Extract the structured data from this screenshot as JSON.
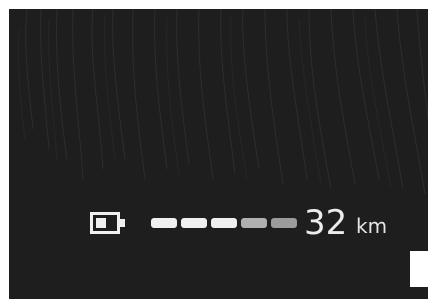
{
  "range_display": {
    "value": "32",
    "unit": "km",
    "icon": "battery-icon",
    "segments": [
      {
        "state": "filled",
        "color": "#f0f0f0"
      },
      {
        "state": "filled",
        "color": "#f0f0f0"
      },
      {
        "state": "filled",
        "color": "#f0f0f0"
      },
      {
        "state": "dim",
        "color": "#b0b0b0"
      },
      {
        "state": "dim",
        "color": "#9c9c9c"
      }
    ]
  },
  "reference_code": "",
  "colors": {
    "screen_background": "#1e1e1e",
    "foreground": "#ececec"
  }
}
